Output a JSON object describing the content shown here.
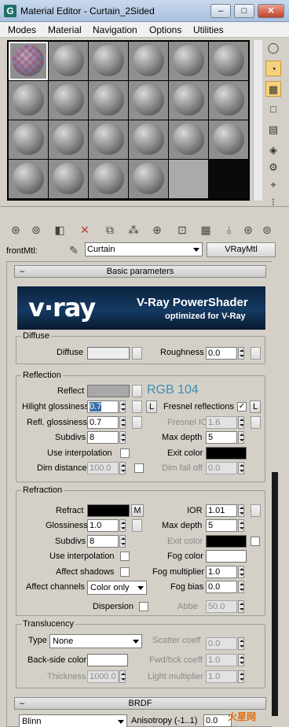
{
  "window": {
    "title": "Material Editor - Curtain_2Sided",
    "app_icon": "G",
    "min": "–",
    "max": "□",
    "close": "✕"
  },
  "menu": [
    "Modes",
    "Material",
    "Navigation",
    "Options",
    "Utilities"
  ],
  "name_row": {
    "label": "frontMtl:",
    "material_name": "Curtain",
    "type_button": "VRayMtl"
  },
  "rollouts": {
    "basic": "Basic parameters",
    "brdf": "BRDF"
  },
  "banner": {
    "logo": "v·ray",
    "title": "V-Ray PowerShader",
    "subtitle": "optimized for V-Ray"
  },
  "diffuse": {
    "group": "Diffuse",
    "diffuse_label": "Diffuse",
    "diffuse_color": "#eeeeee",
    "roughness_label": "Roughness",
    "roughness": "0.0"
  },
  "reflection": {
    "group": "Reflection",
    "reflect_label": "Reflect",
    "reflect_color": "#a8a8a8",
    "rgb_readout": "RGB 104",
    "hilight_label": "Hilight glossiness",
    "hilight": "0.7",
    "l_button": "L",
    "fresnel_label": "Fresnel reflections",
    "fresnel_checked": "✓",
    "fresnel_ior_label": "Fresnel IOR",
    "fresnel_ior": "1.6",
    "refl_gloss_label": "Refl. glossiness",
    "refl_gloss": "0.7",
    "subdivs_label": "Subdivs",
    "subdivs": "8",
    "max_depth_label": "Max depth",
    "max_depth": "5",
    "use_interp_label": "Use interpolation",
    "exit_color_label": "Exit color",
    "exit_color": "#000000",
    "dim_distance_label": "Dim distance",
    "dim_distance": "100.0",
    "dim_falloff_label": "Dim fall off",
    "dim_falloff": "0.0"
  },
  "refraction": {
    "group": "Refraction",
    "refract_label": "Refract",
    "refract_color": "#000000",
    "m_button": "M",
    "ior_label": "IOR",
    "ior": "1.01",
    "glossiness_label": "Glossiness",
    "glossiness": "1.0",
    "max_depth_label": "Max depth",
    "max_depth": "5",
    "subdivs_label": "Subdivs",
    "subdivs": "8",
    "exit_color_label": "Exit color",
    "use_interp_label": "Use interpolation",
    "fog_color_label": "Fog color",
    "fog_color": "#ffffff",
    "affect_shadows_label": "Affect shadows",
    "fog_mult_label": "Fog multiplier",
    "fog_mult": "1.0",
    "affect_channels_label": "Affect channels",
    "affect_channels": "Color only",
    "fog_bias_label": "Fog bias",
    "fog_bias": "0.0",
    "dispersion_label": "Dispersion",
    "abbe_label": "Abbe",
    "abbe": "50.0"
  },
  "translucency": {
    "group": "Translucency",
    "type_label": "Type",
    "type_value": "None",
    "scatter_label": "Scatter coeff",
    "scatter": "0.0",
    "backside_label": "Back-side color",
    "backside_color": "#ffffff",
    "fwd_label": "Fwd/bck coeff",
    "fwd": "1.0",
    "thickness_label": "Thickness",
    "thickness": "1000.0",
    "light_mult_label": "Light multiplier",
    "light_mult": "1.0"
  },
  "brdf": {
    "type_value": "Blinn",
    "anisotropy_label": "Anisotropy (-1..1)",
    "anisotropy": "0.0"
  },
  "watermark": "火星网"
}
